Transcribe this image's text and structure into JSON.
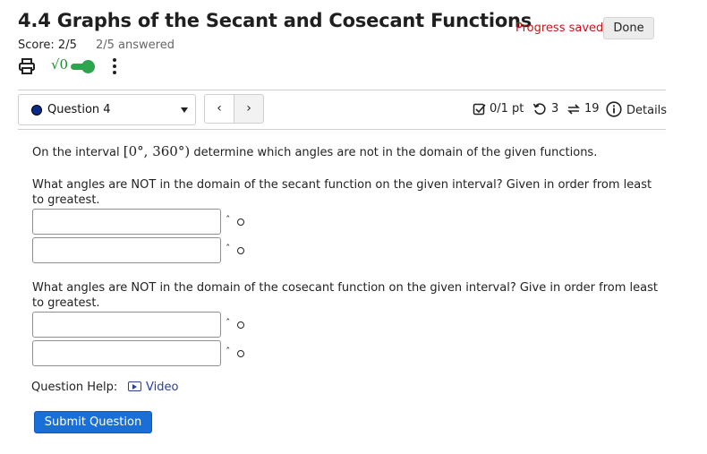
{
  "header": {
    "title": "4.4 Graphs of the Secant and Cosecant Functions",
    "score": "Score: 2/5",
    "answered": "2/5 answered",
    "progress_status": "Progress saved",
    "done_label": "Done"
  },
  "toolbar": {
    "print_icon": "print-icon",
    "sqrt_label": "√0",
    "math_toggle_on": true,
    "more_icon": "vertical-dots-icon"
  },
  "question_nav": {
    "selected": "Question 4",
    "prev_glyph": "‹",
    "next_glyph": "›"
  },
  "metrics": {
    "points": "0/1 pt",
    "retries": "3",
    "attempts": "19",
    "details_label": "Details"
  },
  "question": {
    "intro_prefix": "On the interval",
    "interval": "[0°, 360°)",
    "intro_suffix": "determine which angles are not in the domain of the given functions.",
    "part1": "What angles are NOT in the domain of the secant function on the given interval? Given in order from least to greatest.",
    "part2": "What angles are NOT in the domain of the cosecant function on the given interval? Give in order from least to greatest.",
    "answers": [
      "",
      "",
      "",
      ""
    ],
    "superscript_hint": "ˆ"
  },
  "help": {
    "label": "Question Help:",
    "video_label": "Video"
  },
  "submit_label": "Submit Question",
  "colors": {
    "progress": "#c21616",
    "toggle": "#2ea44f",
    "link": "#2a3f96",
    "submit": "#1a6fd6",
    "question_dot": "#0a2a8c"
  }
}
